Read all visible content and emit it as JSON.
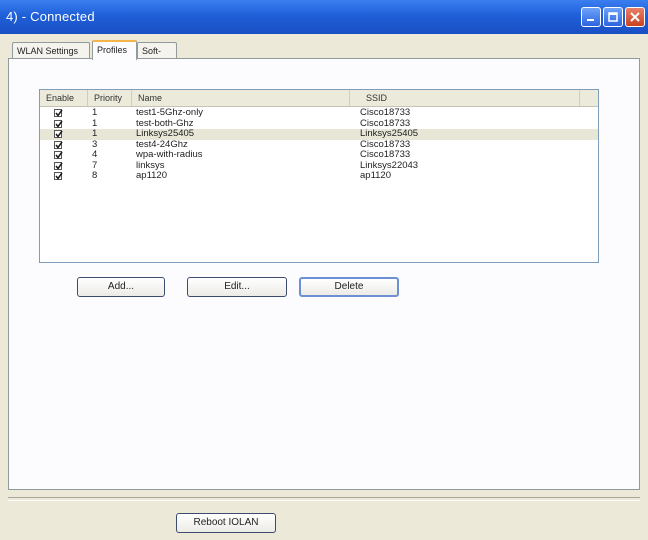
{
  "window": {
    "title": "4) - Connected"
  },
  "tabs": [
    {
      "label": "WLAN Settings",
      "active": false
    },
    {
      "label": "Profiles",
      "active": true
    },
    {
      "label": "Soft-AP",
      "active": false
    }
  ],
  "profiles_list": {
    "columns": [
      "Enable",
      "Priority",
      "Name",
      "SSID"
    ],
    "rows": [
      {
        "enabled": true,
        "priority": "1",
        "name": "test1-5Ghz-only",
        "ssid": "Cisco18733",
        "selected": false
      },
      {
        "enabled": true,
        "priority": "1",
        "name": "test-both-Ghz",
        "ssid": "Cisco18733",
        "selected": false
      },
      {
        "enabled": true,
        "priority": "1",
        "name": "Linksys25405",
        "ssid": "Linksys25405",
        "selected": true
      },
      {
        "enabled": true,
        "priority": "3",
        "name": "test4-24Ghz",
        "ssid": "Cisco18733",
        "selected": false
      },
      {
        "enabled": true,
        "priority": "4",
        "name": "wpa-with-radius",
        "ssid": "Cisco18733",
        "selected": false
      },
      {
        "enabled": true,
        "priority": "7",
        "name": "linksys",
        "ssid": "Linksys22043",
        "selected": false
      },
      {
        "enabled": true,
        "priority": "8",
        "name": "ap1120",
        "ssid": "ap1120",
        "selected": false
      }
    ]
  },
  "buttons": {
    "add": "Add...",
    "edit": "Edit...",
    "delete": "Delete",
    "reboot": "Reboot IOLAN"
  }
}
